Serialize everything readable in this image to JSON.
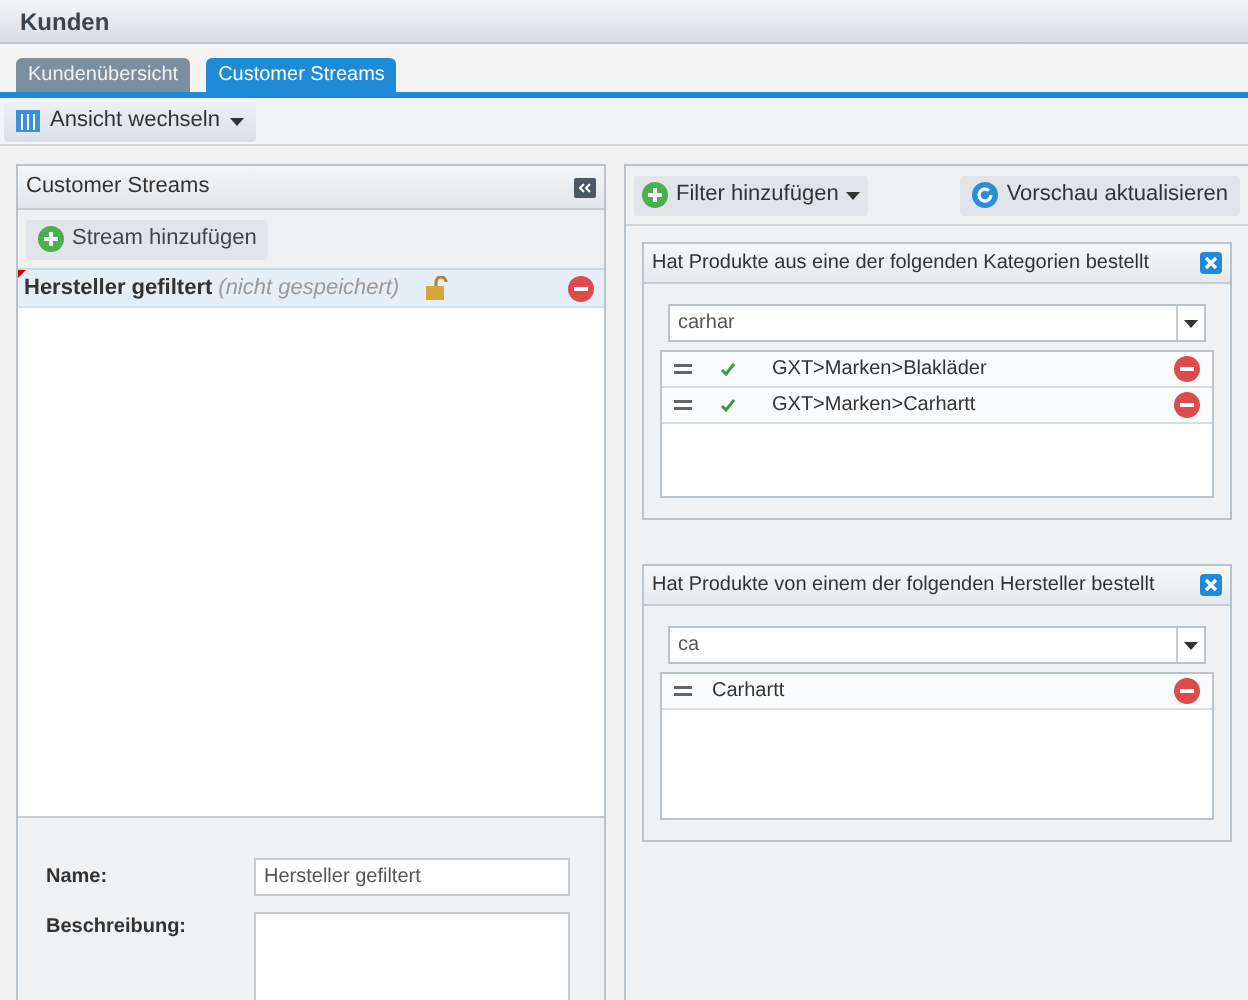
{
  "window": {
    "title": "Kunden"
  },
  "tabs": [
    {
      "label": "Kundenübersicht",
      "selected": false
    },
    {
      "label": "Customer Streams",
      "selected": true
    }
  ],
  "toolbar": {
    "view_button": "Ansicht wechseln"
  },
  "streams_panel": {
    "title": "Customer Streams",
    "add_button": "Stream hinzufügen",
    "items": [
      {
        "name": "Hersteller gefiltert",
        "status": "(nicht gespeichert)",
        "selected": true,
        "unsaved": true,
        "unlocked": true
      }
    ],
    "form": {
      "name_label": "Name:",
      "name_value": "Hersteller gefiltert",
      "description_label": "Beschreibung:"
    }
  },
  "filter_panel": {
    "add_filter_button": "Filter hinzufügen",
    "refresh_button": "Vorschau aktualisieren",
    "filters": [
      {
        "title": "Hat Produkte aus eine der folgenden Kategorien bestellt",
        "search_value": "carhar",
        "items": [
          {
            "label": "GXT>Marken>Blakläder",
            "checked": true
          },
          {
            "label": "GXT>Marken>Carhartt",
            "checked": true
          }
        ]
      },
      {
        "title": "Hat Produkte von einem der folgenden Hersteller bestellt",
        "search_value": "ca",
        "items": [
          {
            "label": "Carhartt"
          }
        ]
      }
    ]
  }
}
